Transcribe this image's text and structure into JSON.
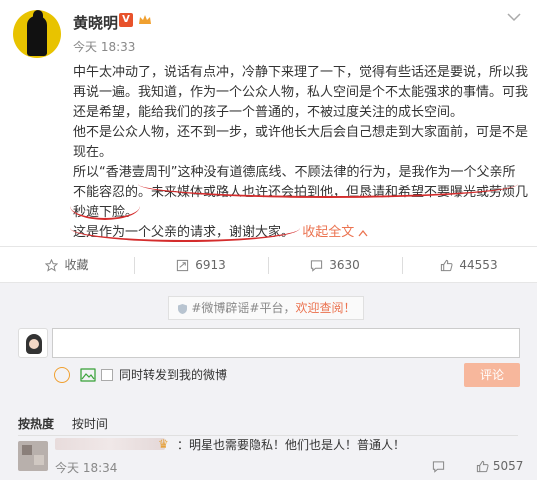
{
  "post": {
    "user_name": "黄晓明",
    "verified_mark": "V",
    "time": "今天 18:33",
    "paragraphs": [
      "中午太冲动了，说话有点冲，冷静下来理了一下，觉得有些话还是要说，所以我再说一遍。我知道，作为一个公众人物，私人空间是个不太能强求的事情。可我还是希望，能给我们的孩子一个普通的，不被过度关注的成长空间。",
      "他不是公众人物，还不到一步，或许他长大后会自己想走到大家面前，可是不是现在。",
      "所以“香港壹周刊”这种没有道德底线、不顾法律的行为，是我作为一个父亲所不能容忍的。未来媒体或路人也许还会拍到他，但恳请和希望不要曝光或劳烦几秒遮下脸。",
      "这是作为一个父亲的请求，谢谢大家。"
    ],
    "collapse_label": "收起全文",
    "collapse_icon": "chevron-up-icon"
  },
  "actions": {
    "favorite": {
      "label": "收藏",
      "icon": "star-icon"
    },
    "repost": {
      "label": "6913",
      "icon": "repost-icon"
    },
    "comment": {
      "label": "3630",
      "icon": "comment-icon"
    },
    "like": {
      "label": "44553",
      "icon": "thumbs-up-icon"
    }
  },
  "comment_box": {
    "notice_prefix": "#微博辟谣#平台，",
    "notice_link": "欢迎查阅！",
    "input_placeholder": "",
    "share_label": "同时转发到我的微博",
    "submit_label": "评论"
  },
  "comment_list": {
    "tabs": [
      "按热度",
      "按时间"
    ],
    "comments": [
      {
        "text": "：明星也需要隐私！他们也是人！普通人！",
        "time": "今天 18:34",
        "reply_icon": "comment-icon",
        "likes": "5057"
      }
    ]
  },
  "colors": {
    "accent": "#eb7350",
    "highlight_underline": "#d42c2c",
    "submit_button": "#f7b79c"
  }
}
